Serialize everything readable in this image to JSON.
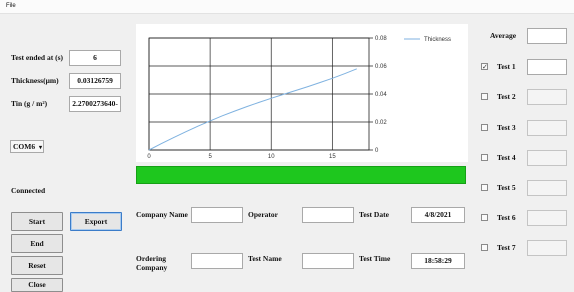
{
  "menu": {
    "file": "File"
  },
  "left_panel": {
    "test_ended_label": "Test ended at (s)",
    "test_ended_value": "6",
    "thickness_label": "Thickness(μm)",
    "thickness_value": "0.03126759",
    "tin_label": "Tin (g / m²)",
    "tin_value": "2.2700273640-",
    "port_selected": "COM6",
    "connection_status": "Connected"
  },
  "buttons": {
    "start": "Start",
    "export": "Export",
    "end": "End",
    "reset": "Reset",
    "close": "Close"
  },
  "form": {
    "company_name_label": "Company Name",
    "company_name_value": "",
    "operator_label": "Operator",
    "operator_value": "",
    "test_date_label": "Test Date",
    "test_date_value": "4/8/2021",
    "ordering_company_label": "Ordering Company",
    "ordering_company_value": "",
    "test_name_label": "Test Name",
    "test_name_value": "",
    "test_time_label": "Test Time",
    "test_time_value": "18:58:29"
  },
  "right_panel": {
    "average_label": "Average",
    "average_value": "",
    "tests": [
      {
        "label": "Test 1",
        "checked": true,
        "enabled": true,
        "value": ""
      },
      {
        "label": "Test 2",
        "checked": false,
        "enabled": false,
        "value": ""
      },
      {
        "label": "Test 3",
        "checked": false,
        "enabled": false,
        "value": ""
      },
      {
        "label": "Test 4",
        "checked": false,
        "enabled": false,
        "value": ""
      },
      {
        "label": "Test 5",
        "checked": false,
        "enabled": false,
        "value": ""
      },
      {
        "label": "Test 6",
        "checked": false,
        "enabled": false,
        "value": ""
      },
      {
        "label": "Test 7",
        "checked": false,
        "enabled": false,
        "value": ""
      }
    ]
  },
  "colors": {
    "progress_fill": "#1ec71e",
    "series_line": "#7fb2e0"
  },
  "chart_data": {
    "type": "line",
    "title": "",
    "xlabel": "",
    "ylabel": "",
    "xlim": [
      0,
      18
    ],
    "ylim": [
      0,
      0.08
    ],
    "grid": true,
    "legend_position": "top-right",
    "x_ticks": [
      "0",
      "5",
      "10",
      "15"
    ],
    "y_ticks": [
      "0",
      "0.02",
      "0.04",
      "0.06",
      "0.08"
    ],
    "series": [
      {
        "name": "Thickness",
        "x": [
          0,
          1,
          2,
          3,
          4,
          5,
          6,
          7,
          8,
          9,
          10,
          11,
          12,
          13,
          14,
          15,
          16,
          17
        ],
        "y": [
          0.0,
          0.0045,
          0.0088,
          0.013,
          0.017,
          0.0208,
          0.0244,
          0.0278,
          0.031,
          0.034,
          0.0369,
          0.0397,
          0.0425,
          0.0453,
          0.0482,
          0.0512,
          0.0545,
          0.058
        ]
      }
    ]
  }
}
